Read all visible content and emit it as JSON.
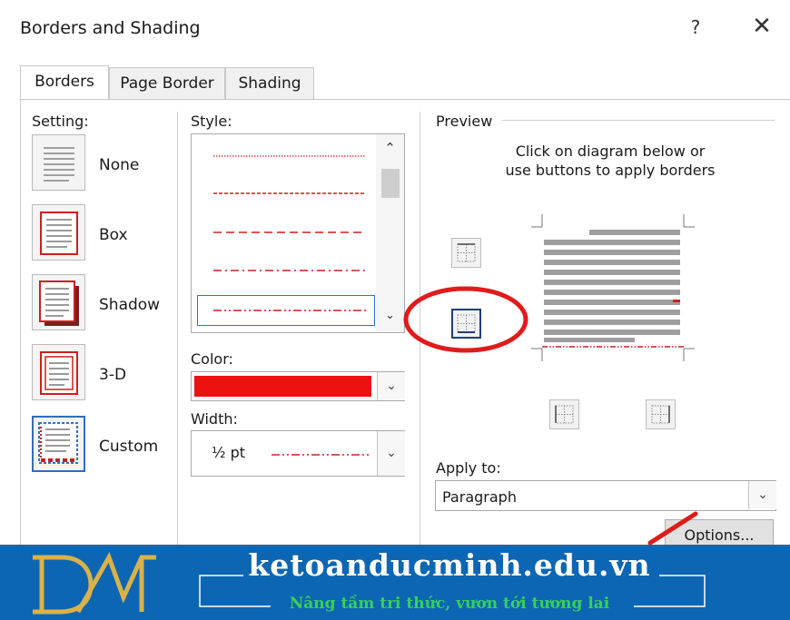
{
  "window": {
    "title": "Borders and Shading",
    "help_label": "?",
    "close_label": "✕"
  },
  "tabs": [
    {
      "label": "Borders",
      "active": true
    },
    {
      "label": "Page Border",
      "active": false
    },
    {
      "label": "Shading",
      "active": false
    }
  ],
  "setting": {
    "label": "Setting:",
    "items": [
      {
        "label": "None",
        "icon": "setting-none-icon"
      },
      {
        "label": "Box",
        "icon": "setting-box-icon"
      },
      {
        "label": "Shadow",
        "icon": "setting-shadow-icon"
      },
      {
        "label": "3-D",
        "icon": "setting-3d-icon"
      },
      {
        "label": "Custom",
        "icon": "setting-custom-icon",
        "selected": true
      }
    ]
  },
  "style": {
    "label": "Style:",
    "options": [
      "dotted",
      "dash-small",
      "dash-large",
      "dash-dot",
      "dash-dot-dot"
    ],
    "selected": "dash-dot-dot"
  },
  "color": {
    "label": "Color:",
    "value": "#ee1111"
  },
  "width": {
    "label": "Width:",
    "value": "½ pt"
  },
  "preview": {
    "label": "Preview",
    "hint_line1": "Click on diagram below or",
    "hint_line2": "use buttons to apply borders"
  },
  "apply_to": {
    "label": "Apply to:",
    "value": "Paragraph"
  },
  "options_button": "Options...",
  "banner": {
    "site": "ketoanducminh.edu.vn",
    "tagline": "Nâng tầm tri thức, vươn tới tương lai",
    "logo_text": "DM"
  },
  "colors": {
    "accent_red": "#cc1f1f",
    "banner_blue": "#0d66b3",
    "tagline_green": "#36d05a",
    "logo_gold": "#d9b24a"
  }
}
